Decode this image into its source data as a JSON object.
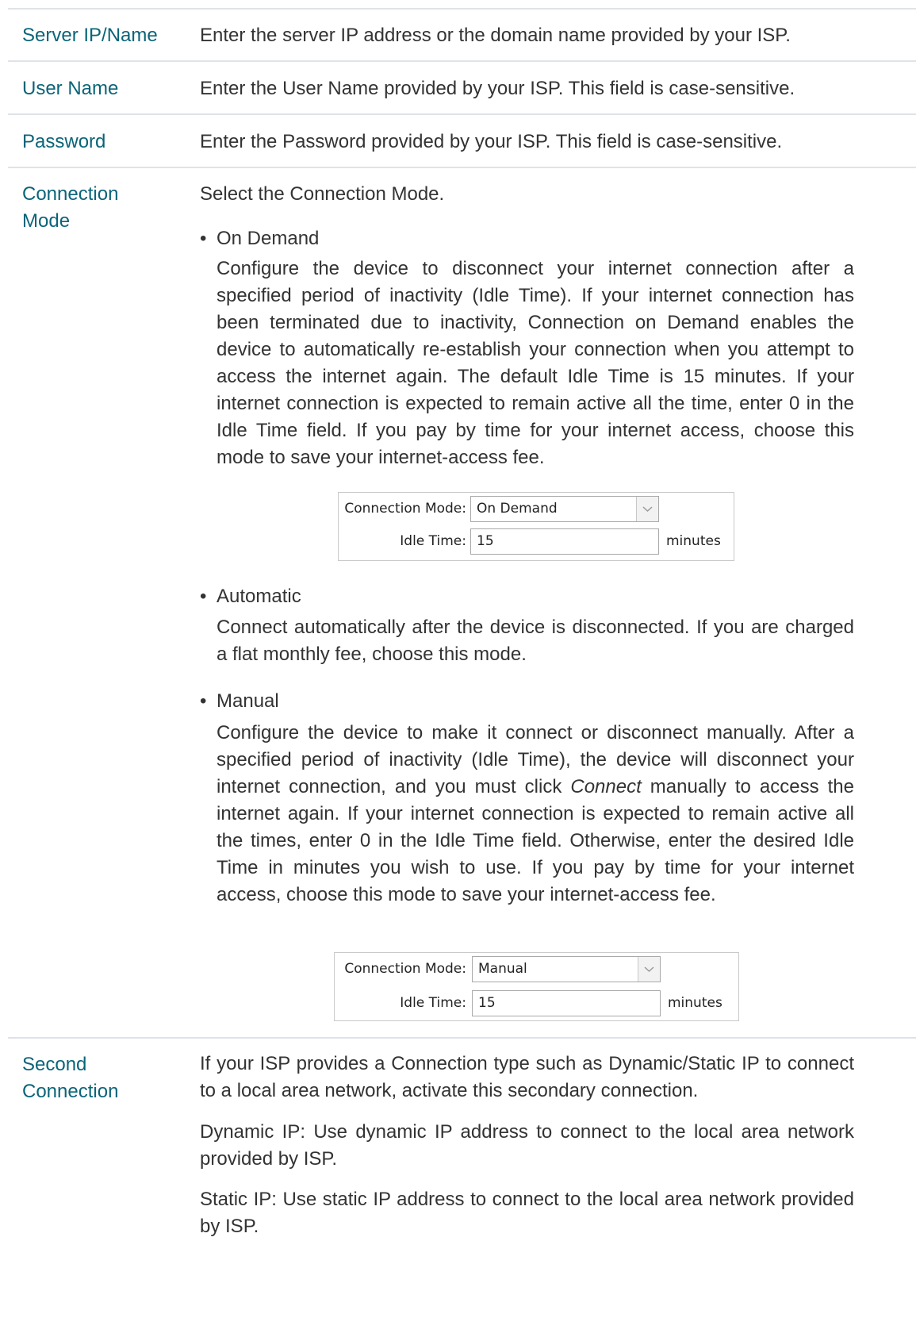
{
  "rows": {
    "server": {
      "label": "Server IP/Name",
      "desc": "Enter the server IP address or the domain name provided by your ISP."
    },
    "username": {
      "label": "User Name",
      "desc": "Enter the User Name provided by your ISP. This field is case-sensitive."
    },
    "password": {
      "label": "Password",
      "desc": "Enter the Password provided by your ISP. This field is case-sensitive."
    },
    "connection_mode": {
      "label_line1": "Connection",
      "label_line2": "Mode",
      "intro": "Select the Connection Mode.",
      "on_demand": {
        "title": "On Demand",
        "text": "Configure the device to disconnect your internet connection after a specified period of inactivity (Idle Time). If your internet connection has been terminated due to inactivity, Connection on Demand enables the device to automatically re-establish your connection when you attempt to access the internet again. The default Idle Time is 15 minutes. If your internet connection is expected to remain active all the time, enter 0 in the Idle Time field. If you pay by time for your internet access, choose this mode to save your internet-access fee.",
        "shot": {
          "mode_label": "Connection Mode:",
          "mode_value": "On Demand",
          "idle_label": "Idle Time:",
          "idle_value": "15",
          "unit": "minutes"
        }
      },
      "automatic": {
        "title": "Automatic",
        "text": "Connect automatically after the device is disconnected. If you are charged a flat monthly fee, choose this mode."
      },
      "manual": {
        "title": "Manual",
        "text_before": "Configure the device to make it connect or disconnect manually. After a specified period of inactivity (Idle Time), the device will disconnect your internet connection, and you must click ",
        "text_italic": "Connect",
        "text_after": " manually to access the internet again. If your internet connection is expected to remain active all the times, enter 0 in the Idle Time field. Otherwise, enter the desired Idle Time in minutes you wish to use. If you pay by time for your internet access, choose this mode to save your internet-access fee.",
        "shot": {
          "mode_label": "Connection Mode:",
          "mode_value": "Manual",
          "idle_label": "Idle Time:",
          "idle_value": "15",
          "unit": "minutes"
        }
      }
    },
    "second": {
      "label_line1": "Second",
      "label_line2": "Connection",
      "intro": "If your ISP provides a Connection type such as Dynamic/Static IP to connect to a local area network, activate this secondary connection.",
      "dynamic_term": "Dynamic IP:",
      "dynamic_text": " Use dynamic IP address to connect to the local area network provided by ISP.",
      "static_term": "Static IP:",
      "static_text": " Use static IP address to connect to the local area network provided by ISP."
    }
  },
  "colors": {
    "label": "#0a6478",
    "body_text": "#333333",
    "separator": "#dfe3e8"
  }
}
